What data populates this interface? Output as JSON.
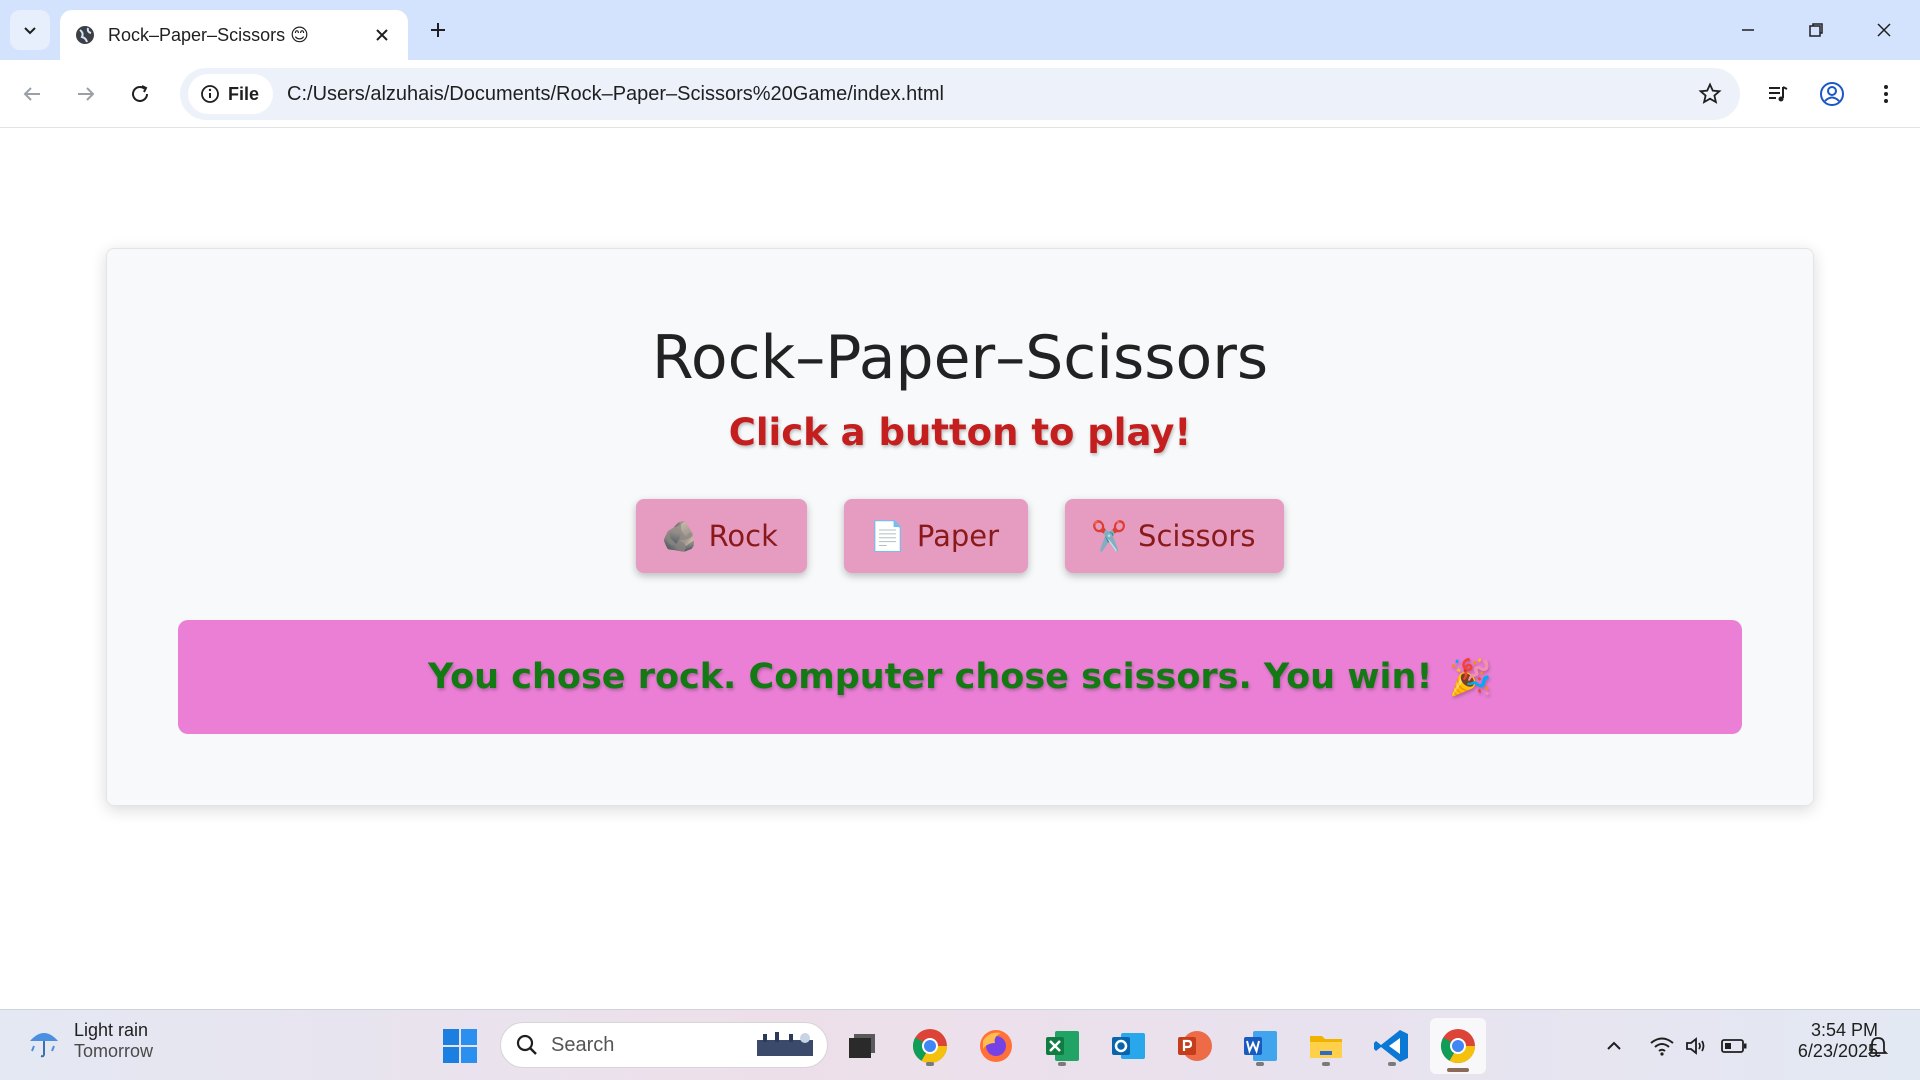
{
  "browser": {
    "tab_title": "Rock–Paper–Scissors 😊",
    "site_info_label": "File",
    "url": "C:/Users/alzuhais/Documents/Rock–Paper–Scissors%20Game/index.html"
  },
  "game": {
    "title": "Rock–Paper–Scissors",
    "prompt": "Click a button to play!",
    "choices": [
      {
        "label": "Rock",
        "icon": "rock-icon",
        "emoji": "🪨"
      },
      {
        "label": "Paper",
        "icon": "paper-icon",
        "emoji": "📄"
      },
      {
        "label": "Scissors",
        "icon": "scissors-icon",
        "emoji": "✂️"
      }
    ],
    "result_text": "You chose rock. Computer chose scissors. You win!",
    "result_emoji": "🎉",
    "colors": {
      "prompt": "#c41e1e",
      "button_bg": "#e69cc0",
      "result_bg": "#eb7fd6",
      "result_text": "#137a13"
    }
  },
  "taskbar": {
    "weather_condition": "Light rain",
    "weather_when": "Tomorrow",
    "search_placeholder": "Search",
    "time": "3:54 PM",
    "date": "6/23/2025",
    "apps": [
      "file-explorer",
      "chrome",
      "firefox",
      "excel",
      "outlook",
      "powerpoint",
      "word",
      "folder",
      "vscode",
      "chrome"
    ]
  }
}
